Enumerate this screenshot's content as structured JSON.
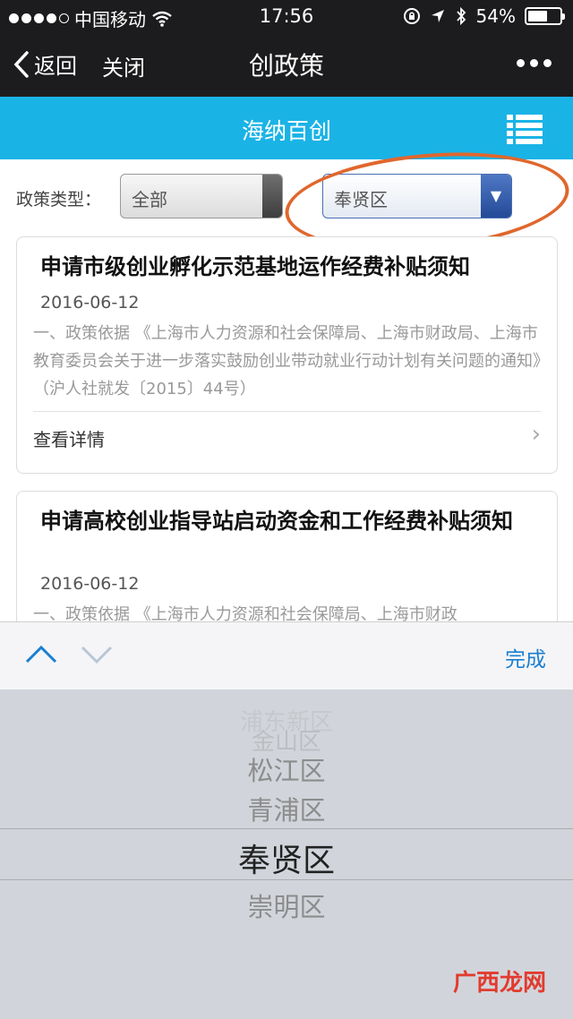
{
  "status_bar": {
    "carrier": "中国移动",
    "time": "17:56",
    "battery": "54%",
    "battery_level": 0.54
  },
  "nav": {
    "back_label": "返回",
    "close_label": "关闭",
    "title": "创政策"
  },
  "header": {
    "title": "海纳百创"
  },
  "filter": {
    "label": "政策类型：",
    "type_value": "全部",
    "district_value": "奉贤区"
  },
  "cards": [
    {
      "title": "申请市级创业孵化示范基地运作经费补贴须知",
      "date": "2016-06-12",
      "summary": "一、政策依据 《上海市人力资源和社会保障局、上海市财政局、上海市教育委员会关于进一步落实鼓励创业带动就业行动计划有关问题的通知》（沪人社就发〔2015〕44号）",
      "detail_label": "查看详情"
    },
    {
      "title": "申请高校创业指导站启动资金和工作经费补贴须知",
      "date": "2016-06-12",
      "summary": "一、政策依据 《上海市人力资源和社会保障局、上海市财政"
    }
  ],
  "picker": {
    "done_label": "完成",
    "options": [
      "浦东新区",
      "金山区",
      "松江区",
      "青浦区",
      "奉贤区",
      "崇明区"
    ],
    "selected": "奉贤区"
  },
  "watermark": "广西龙网",
  "colors": {
    "header_blue": "#1ab3e6",
    "highlight_ring": "#e0672d",
    "done_blue": "#1a7fd0"
  }
}
